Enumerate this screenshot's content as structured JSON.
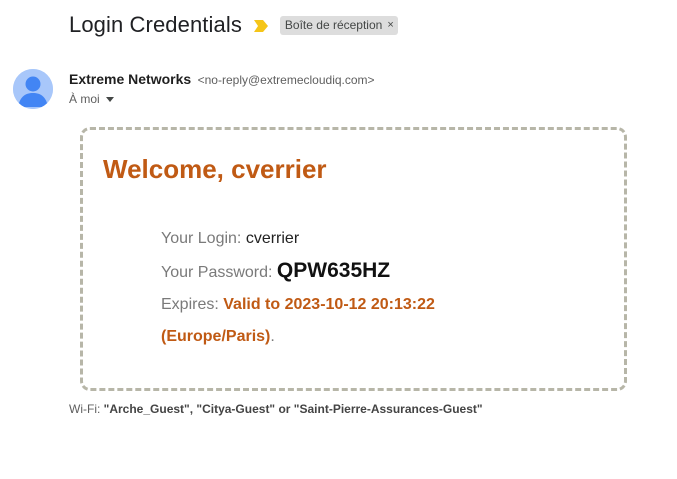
{
  "subject": {
    "title": "Login Credentials",
    "label": "Boîte de réception",
    "label_close": "×"
  },
  "sender": {
    "name": "Extreme Networks",
    "email": "<no-reply@extremecloudiq.com>",
    "recipient": "À moi"
  },
  "card": {
    "welcome": "Welcome, cverrier",
    "login_label": "Your Login: ",
    "login_value": "cverrier",
    "password_label": "Your Password: ",
    "password_value": "QPW635HZ",
    "expires_label": "Expires: ",
    "expires_value": "Valid to 2023-10-12 20:13:22",
    "timezone_value": "(Europe/Paris)",
    "timezone_suffix": "."
  },
  "footer": {
    "wifi_label": "Wi-Fi: ",
    "wifi_networks": "\"Arche_Guest\", \"Citya-Guest\" or \"Saint-Pierre-Assurances-Guest\""
  },
  "colors": {
    "accent": "#c05a14",
    "importance": "#f5c518",
    "avatar_bg": "#a8c7fa",
    "avatar_fg": "#4285f4",
    "card_border": "#b7b6a8"
  },
  "icons": {
    "importance": "importance-marker-icon",
    "avatar": "default-avatar-icon",
    "caret": "chevron-down-icon"
  }
}
